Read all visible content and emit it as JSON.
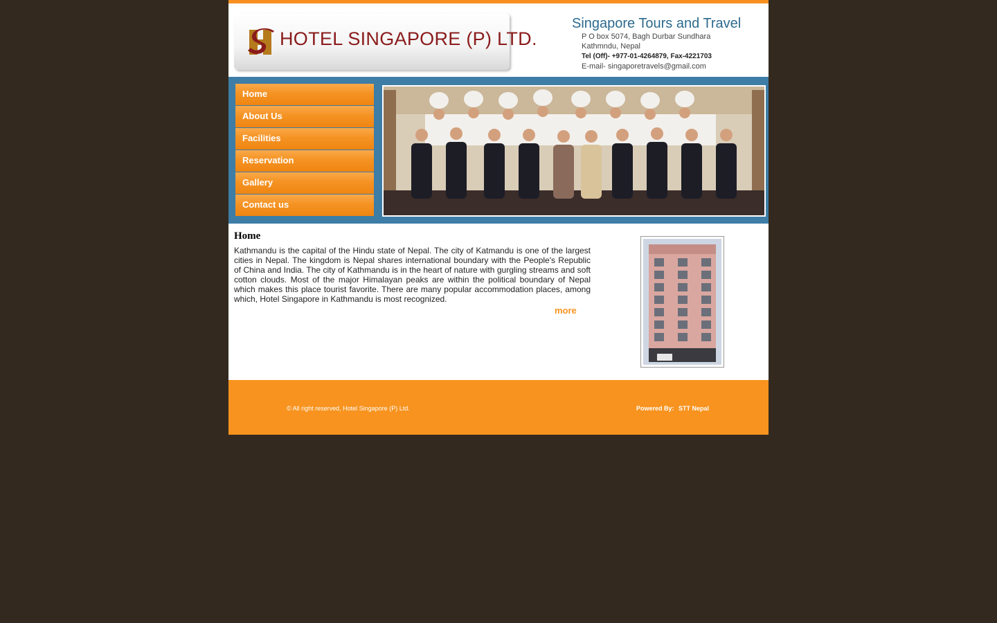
{
  "header": {
    "logo_text": "HOTEL SINGAPORE (P) LTD.",
    "tours_title": "Singapore Tours and Travel",
    "address_line1": "P O box 5074, Bagh Durbar Sundhara",
    "address_line2": "Kathmndu, Nepal",
    "phone": "Tel (Off)- +977-01-4264879, Fax-4221703",
    "email": "E-mail- singaporetravels@gmail.com"
  },
  "menu": {
    "items": [
      {
        "label": "Home"
      },
      {
        "label": "About Us"
      },
      {
        "label": "Facilities"
      },
      {
        "label": "Reservation"
      },
      {
        "label": "Gallery"
      },
      {
        "label": "Contact us"
      }
    ]
  },
  "content": {
    "title": "Home",
    "text": "Kathmandu is the capital of the Hindu state of Nepal. The city of Katmandu is one of the largest cities in Nepal. The kingdom is Nepal shares international boundary with the People's Republic of China and India. The city of Kathmandu is in the heart of nature with gurgling streams and soft cotton clouds. Most of the major Himalayan peaks are within the political boundary of Nepal which makes this place tourist favorite. There are many popular accommodation places, among which, Hotel Singapore in Kathmandu is most recognized.",
    "more_label": "more"
  },
  "footer": {
    "copyright": "© All right reserved, Hotel Singapore (P) Ltd.",
    "powered_by": "Powered By:",
    "powered_link": "STT Nepal"
  },
  "colors": {
    "accent": "#f7931e",
    "band": "#3d7da6",
    "background": "#33291f",
    "logo_red": "#8a1b1b",
    "tours_blue": "#2c6a8e"
  }
}
